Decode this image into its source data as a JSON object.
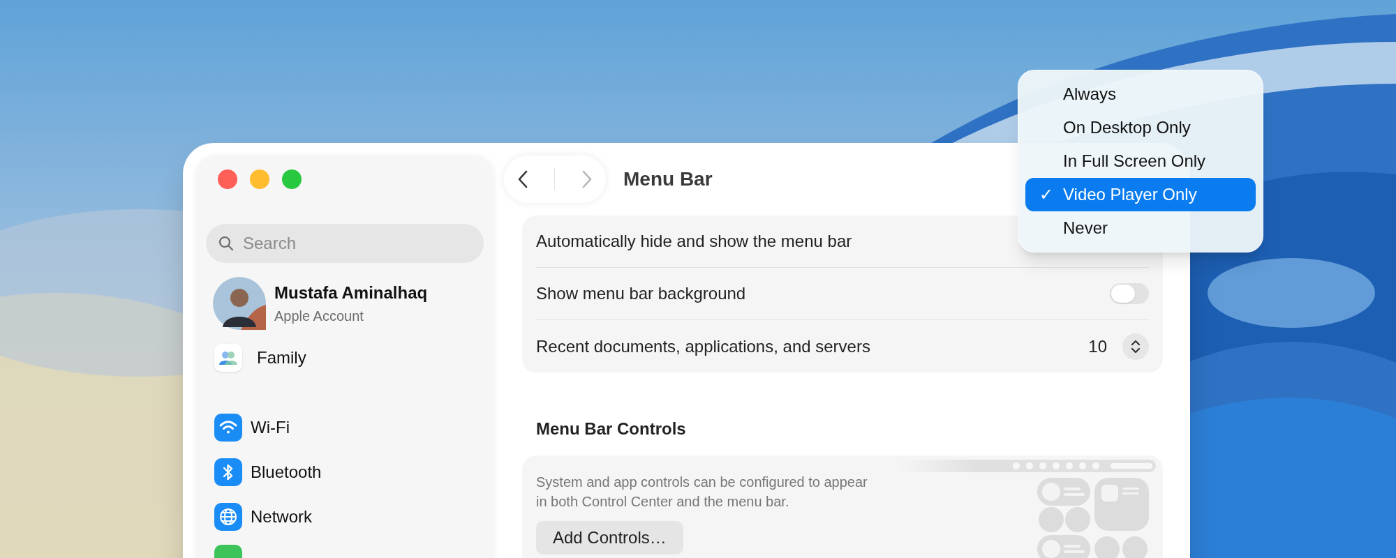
{
  "window": {
    "title": "Menu Bar",
    "nav": {
      "back_disabled": false,
      "forward_disabled": true
    }
  },
  "sidebar": {
    "search": {
      "placeholder": "Search"
    },
    "account": {
      "name": "Mustafa Aminalhaq",
      "subtitle": "Apple Account"
    },
    "items": [
      {
        "label": "Family",
        "kind": "family"
      },
      {
        "label": "Wi-Fi",
        "kind": "wifi"
      },
      {
        "label": "Bluetooth",
        "kind": "bluetooth"
      },
      {
        "label": "Network",
        "kind": "network"
      }
    ]
  },
  "settings": [
    {
      "label": "Automatically hide and show the menu bar",
      "kind": "popup"
    },
    {
      "label": "Show menu bar background",
      "kind": "toggle",
      "on": false
    },
    {
      "label": "Recent documents, applications, and servers",
      "kind": "stepper",
      "value": "10"
    }
  ],
  "section": {
    "title": "Menu Bar Controls",
    "description": "System and app controls can be configured to appear in both Control Center and the menu bar.",
    "button": "Add Controls…"
  },
  "menu": {
    "check": "✓",
    "items": [
      {
        "label": "Always",
        "selected": false
      },
      {
        "label": "On Desktop Only",
        "selected": false
      },
      {
        "label": "In Full Screen Only",
        "selected": false
      },
      {
        "label": "Video Player Only",
        "selected": true
      },
      {
        "label": "Never",
        "selected": false
      }
    ]
  }
}
